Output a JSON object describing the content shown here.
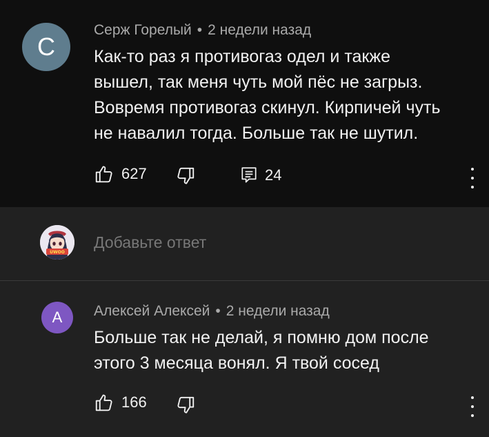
{
  "comments": [
    {
      "avatar_letter": "С",
      "avatar_color": "#5f7d8e",
      "author": "Серж Горелый",
      "separator": "•",
      "time": "2 недели назад",
      "lines": [
        "Как-то раз я противогаз одел и также",
        "вышел, так меня чуть мой пёс не загрыз.",
        "Вовремя противогаз скинул. Кирпичей чуть",
        "не навалил тогда. Больше так не шутил."
      ],
      "likes": "627",
      "replies": "24"
    },
    {
      "avatar_letter": "А",
      "avatar_color": "#7e57c2",
      "author": "Алексей Алексей",
      "separator": "•",
      "time": "2 недели назад",
      "lines": [
        "Больше так не делай, я помню дом после",
        "этого 3 месяца вонял. Я твой сосед"
      ],
      "likes": "166"
    }
  ],
  "reply_box": {
    "placeholder": "Добавьте ответ",
    "avatar_badge": "UWOO"
  },
  "icons": {
    "like": "thumb-up-icon",
    "dislike": "thumb-down-icon",
    "replies": "comment-icon",
    "more": "more-vert-icon"
  },
  "colors": {
    "background": "#0f0f0f",
    "thread_background": "#212121",
    "secondary_text": "#aaaaaa"
  }
}
